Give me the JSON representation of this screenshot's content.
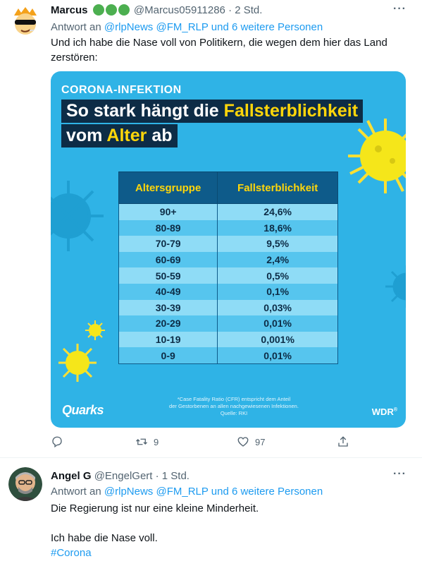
{
  "tweet1": {
    "display_name": "Marcus",
    "handle_time": "@Marcus05911286 · 2 Std.",
    "reply_prefix": "Antwort an",
    "reply_targets": "@rlpNews @FM_RLP und 6 weitere Personen",
    "text": "Und ich habe die Nase voll von Politikern, die wegen dem hier das Land zerstören:",
    "more_label": "···",
    "media": {
      "kicker": "CORONA-INFEKTION",
      "headline1_pre": "So stark hängt die ",
      "headline1_hl": "Fallsterblichkeit",
      "headline2_pre": "vom ",
      "headline2_hl": "Alter",
      "headline2_post": " ab",
      "table_headers": [
        "Altersgruppe",
        "Fallsterblichkeit"
      ],
      "table_rows": [
        [
          "90+",
          "24,6%"
        ],
        [
          "80-89",
          "18,6%"
        ],
        [
          "70-79",
          "9,5%"
        ],
        [
          "60-69",
          "2,4%"
        ],
        [
          "50-59",
          "0,5%"
        ],
        [
          "40-49",
          "0,1%"
        ],
        [
          "30-39",
          "0,03%"
        ],
        [
          "20-29",
          "0,01%"
        ],
        [
          "10-19",
          "0,001%"
        ],
        [
          "0-9",
          "0,01%"
        ]
      ],
      "footnote_line1": "*Case Fatality Ratio (CFR) entspricht dem Anteil",
      "footnote_line2": "der Gestorbenen an allen nachgewiesenen Infektionen.",
      "footnote_line3": "Quelle: RKI",
      "logo_left": "Quarks",
      "logo_right": "WDR",
      "logo_right_mark": "®",
      "colors": {
        "background": "#2fb3e6",
        "headline_bg": "#0d2c46",
        "highlight": "#ffd60a"
      }
    },
    "actions": {
      "reply_icon": "reply-icon",
      "retweet_icon": "retweet-icon",
      "retweet_count": "9",
      "like_icon": "heart-icon",
      "like_count": "97",
      "share_icon": "share-icon"
    }
  },
  "tweet2": {
    "display_name": "Angel G",
    "handle_time": "@EngelGert · 1 Std.",
    "reply_prefix": "Antwort an",
    "reply_targets": "@rlpNews @FM_RLP und 6 weitere Personen",
    "text_line1": "Die Regierung ist nur eine kleine Minderheit.",
    "text_line2": "Ich habe die Nase voll.",
    "hashtag": "#Corona",
    "more_label": "···"
  },
  "colors": {
    "link": "#1d9bf0",
    "muted": "#536471",
    "verified_green": "#4caf50"
  }
}
